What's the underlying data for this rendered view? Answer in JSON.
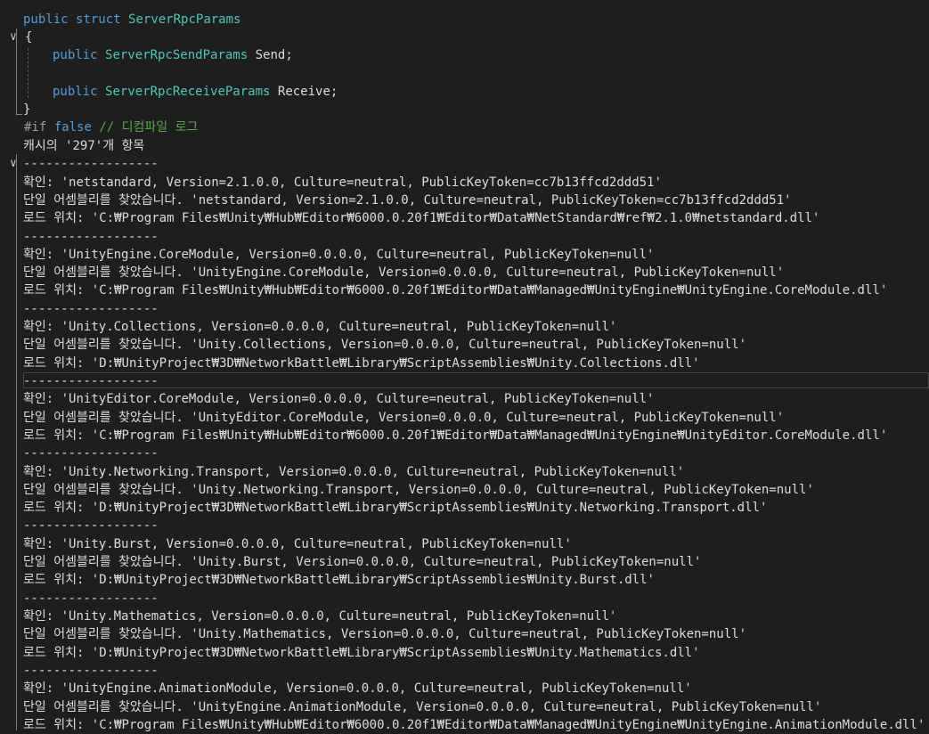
{
  "code": {
    "struct_decl": {
      "kw1": "public",
      "kw2": "struct",
      "name": "ServerRpcParams"
    },
    "open_brace": "{",
    "field1": {
      "kw": "public",
      "type": "ServerRpcSendParams",
      "name": "Send;"
    },
    "field2": {
      "kw": "public",
      "type": "ServerRpcReceiveParams",
      "name": "Receive;"
    },
    "close_brace": "}",
    "directive": {
      "hash": "#if",
      "kw": "false",
      "comment": "// 디컴파일 로그"
    },
    "region_header": "캐시의 '297'개 항목"
  },
  "log": {
    "separator": "------------------",
    "entries": [
      {
        "found": "확인: 'netstandard, Version=2.1.0.0, Culture=neutral, PublicKeyToken=cc7b13ffcd2ddd51'",
        "single": "단일 어셈블리를 찾았습니다. 'netstandard, Version=2.1.0.0, Culture=neutral, PublicKeyToken=cc7b13ffcd2ddd51'",
        "load": "로드 위치: 'C:₩Program Files₩Unity₩Hub₩Editor₩6000.0.20f1₩Editor₩Data₩NetStandard₩ref₩2.1.0₩netstandard.dll'"
      },
      {
        "found": "확인: 'UnityEngine.CoreModule, Version=0.0.0.0, Culture=neutral, PublicKeyToken=null'",
        "single": "단일 어셈블리를 찾았습니다. 'UnityEngine.CoreModule, Version=0.0.0.0, Culture=neutral, PublicKeyToken=null'",
        "load": "로드 위치: 'C:₩Program Files₩Unity₩Hub₩Editor₩6000.0.20f1₩Editor₩Data₩Managed₩UnityEngine₩UnityEngine.CoreModule.dll'"
      },
      {
        "found": "확인: 'Unity.Collections, Version=0.0.0.0, Culture=neutral, PublicKeyToken=null'",
        "single": "단일 어셈블리를 찾았습니다. 'Unity.Collections, Version=0.0.0.0, Culture=neutral, PublicKeyToken=null'",
        "load": "로드 위치: 'D:₩UnityProject₩3D₩NetworkBattle₩Library₩ScriptAssemblies₩Unity.Collections.dll'"
      },
      {
        "found": "확인: 'UnityEditor.CoreModule, Version=0.0.0.0, Culture=neutral, PublicKeyToken=null'",
        "single": "단일 어셈블리를 찾았습니다. 'UnityEditor.CoreModule, Version=0.0.0.0, Culture=neutral, PublicKeyToken=null'",
        "load": "로드 위치: 'C:₩Program Files₩Unity₩Hub₩Editor₩6000.0.20f1₩Editor₩Data₩Managed₩UnityEngine₩UnityEditor.CoreModule.dll'"
      },
      {
        "found": "확인: 'Unity.Networking.Transport, Version=0.0.0.0, Culture=neutral, PublicKeyToken=null'",
        "single": "단일 어셈블리를 찾았습니다. 'Unity.Networking.Transport, Version=0.0.0.0, Culture=neutral, PublicKeyToken=null'",
        "load": "로드 위치: 'D:₩UnityProject₩3D₩NetworkBattle₩Library₩ScriptAssemblies₩Unity.Networking.Transport.dll'"
      },
      {
        "found": "확인: 'Unity.Burst, Version=0.0.0.0, Culture=neutral, PublicKeyToken=null'",
        "single": "단일 어셈블리를 찾았습니다. 'Unity.Burst, Version=0.0.0.0, Culture=neutral, PublicKeyToken=null'",
        "load": "로드 위치: 'D:₩UnityProject₩3D₩NetworkBattle₩Library₩ScriptAssemblies₩Unity.Burst.dll'"
      },
      {
        "found": "확인: 'Unity.Mathematics, Version=0.0.0.0, Culture=neutral, PublicKeyToken=null'",
        "single": "단일 어셈블리를 찾았습니다. 'Unity.Mathematics, Version=0.0.0.0, Culture=neutral, PublicKeyToken=null'",
        "load": "로드 위치: 'D:₩UnityProject₩3D₩NetworkBattle₩Library₩ScriptAssemblies₩Unity.Mathematics.dll'"
      },
      {
        "found": "확인: 'UnityEngine.AnimationModule, Version=0.0.0.0, Culture=neutral, PublicKeyToken=null'",
        "single": "단일 어셈블리를 찾았습니다. 'UnityEngine.AnimationModule, Version=0.0.0.0, Culture=neutral, PublicKeyToken=null'",
        "load": "로드 위치: 'C:₩Program Files₩Unity₩Hub₩Editor₩6000.0.20f1₩Editor₩Data₩Managed₩UnityEngine₩UnityEngine.AnimationModule.dll'"
      }
    ]
  },
  "icons": {
    "fold": "chevron-down-icon"
  },
  "colors": {
    "background": "#1e1e1e",
    "keyword": "#569cd6",
    "type": "#4ec9b0",
    "comment": "#57a64a",
    "text": "#dcdcdc"
  }
}
